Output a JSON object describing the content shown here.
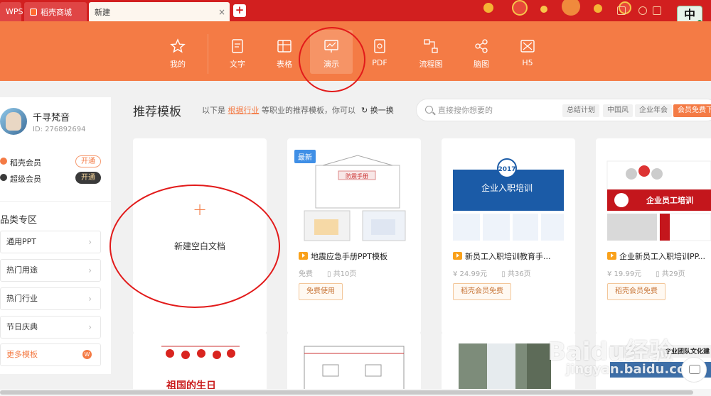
{
  "tabs": {
    "wps": "WPS",
    "mall": "稻壳商城",
    "new": "新建",
    "close": "×",
    "add": "+"
  },
  "ime": {
    "label": "中"
  },
  "toolbar": {
    "items": [
      {
        "label": "我的",
        "icon": "star-icon"
      },
      {
        "label": "文字",
        "icon": "document-icon"
      },
      {
        "label": "表格",
        "icon": "table-icon"
      },
      {
        "label": "演示",
        "icon": "presentation-icon"
      },
      {
        "label": "PDF",
        "icon": "pdf-icon"
      },
      {
        "label": "流程图",
        "icon": "flowchart-icon"
      },
      {
        "label": "脑图",
        "icon": "mindmap-icon"
      },
      {
        "label": "H5",
        "icon": "h5-icon"
      }
    ]
  },
  "user": {
    "name": "千寻梵音",
    "id": "ID: 276892694",
    "memberships": [
      {
        "label": "稻壳会员",
        "action": "开通"
      },
      {
        "label": "超级会员",
        "action": "开通"
      }
    ]
  },
  "categories": {
    "title": "品类专区",
    "items": [
      "通用PPT",
      "热门用途",
      "热门行业",
      "节日庆典"
    ],
    "more": "更多模板",
    "more_icon": "W"
  },
  "header": {
    "title": "推荐模板",
    "subtitle_prefix": "以下是",
    "subtitle_link": "根据行业",
    "subtitle_suffix": "等职业的推荐模板，你可以",
    "refresh": "换一换"
  },
  "search": {
    "placeholder": "直接搜你想要的",
    "tags": [
      "总结计划",
      "中国风",
      "企业年会",
      "会员免费下"
    ]
  },
  "blank_card": {
    "plus": "+",
    "label": "新建空白文档"
  },
  "templates": [
    {
      "badge": "最新",
      "title": "地震应急手册PPT模板",
      "price": "免费",
      "pages": "共10页",
      "button": "免费使用",
      "thumb_text": "防震手册"
    },
    {
      "title": "新员工入职培训教育手...",
      "price": "24.99元",
      "pages": "共36页",
      "button": "稻壳会员免费",
      "thumb_text": "企业入职培训",
      "thumb_year": "2017"
    },
    {
      "title": "企业新员工入职培训PP...",
      "price": "19.99元",
      "pages": "共29页",
      "button": "稻壳会员免费",
      "thumb_text": "企业员工培训"
    }
  ],
  "bottom_thumbs": [
    "祖国的生日",
    "企业团队文化建"
  ],
  "watermark": {
    "main": "Baidu经验",
    "sub": "jingyan.baidu.com"
  },
  "colors": {
    "accent": "#f47b45",
    "tabbar": "#d21f1f",
    "annotation": "#e21a1a"
  }
}
